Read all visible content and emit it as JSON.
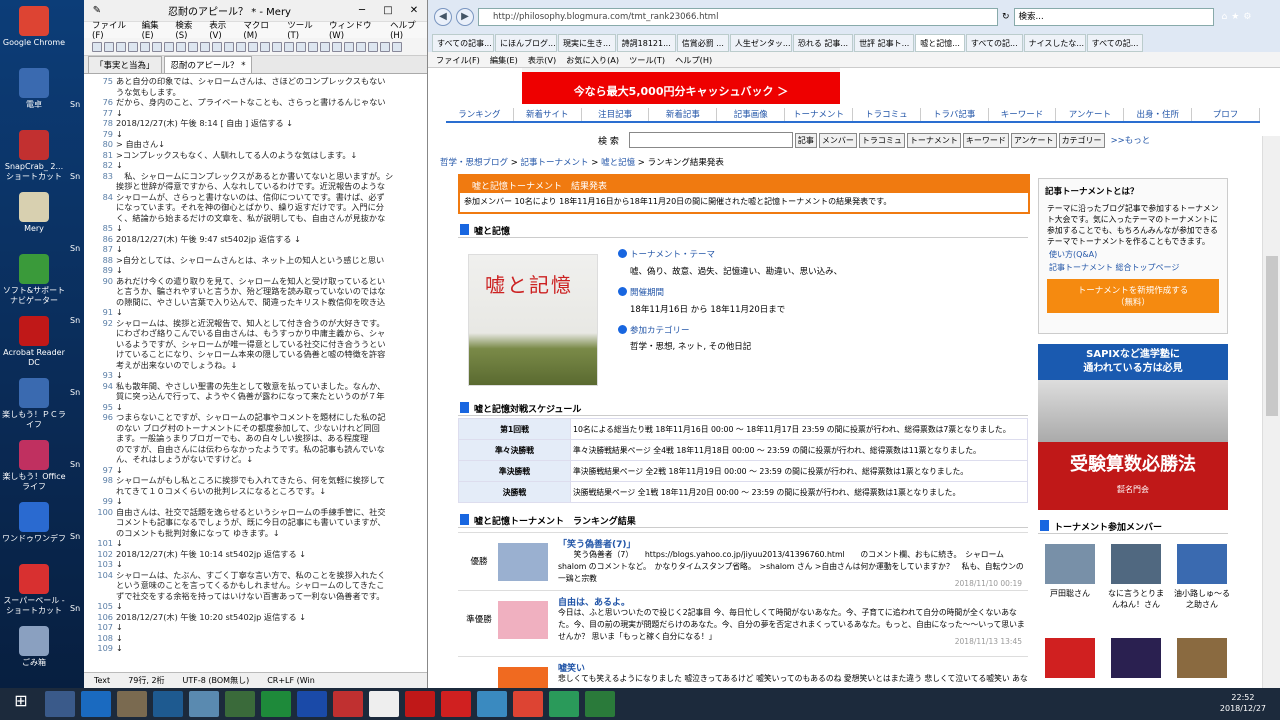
{
  "desktop": {
    "icons": [
      {
        "label": "Google Chrome",
        "color": "#dd4433"
      },
      {
        "label": "電卓",
        "color": "#3a6ab0"
      },
      {
        "label": "SnapCrab_ 2... ショートカット",
        "color": "#c23030"
      },
      {
        "label": "Mery",
        "color": "#d8d0b0"
      },
      {
        "label": "ソフト&サポートナビゲーター",
        "color": "#3a9a3a"
      },
      {
        "label": "Acrobat Reader DC",
        "color": "#c01818"
      },
      {
        "label": "楽しもう！ＰＣライフ",
        "color": "#3a6ab0"
      },
      {
        "label": "楽しもう！Office ライフ",
        "color": "#c03060"
      },
      {
        "label": "ワンドゥワンデフ",
        "color": "#2a6ad0"
      },
      {
        "label": "スーパーペール - ショートカット",
        "color": "#d83030"
      },
      {
        "label": "ごみ箱",
        "color": "#8aa0c0"
      }
    ],
    "side_labels": [
      "Sn",
      "Sn",
      "Sn",
      "Sn",
      "Sn",
      "Sn",
      "Sn",
      "Sn"
    ]
  },
  "mery": {
    "title": "忍耐のアピール？ * - Mery",
    "menu": [
      "ファイル(F)",
      "編集(E)",
      "検索(S)",
      "表示(V)",
      "マクロ(M)",
      "ツール(T)",
      "ウィンドウ(W)",
      "ヘルプ(H)"
    ],
    "tabs": [
      "「事実と当為」",
      "忍耐のアピール？ *"
    ],
    "lines": [
      {
        "n": "75",
        "t": "あと自分の印象では、シャロームさんは、さほどのコンプレックスもない"
      },
      {
        "n": "",
        "t": "うな気もします。"
      },
      {
        "n": "76",
        "t": "だから、身内のこと、プライベートなことも、さらっと書けるんじゃない"
      },
      {
        "n": "77",
        "t": "↓"
      },
      {
        "n": "78",
        "t": "2018/12/27(木) 午後 8:14 [ 自由 ] 返信する ↓"
      },
      {
        "n": "79",
        "t": "↓"
      },
      {
        "n": "80",
        "t": "> 自由さん↓"
      },
      {
        "n": "81",
        "t": ">コンプレックスもなく、人馴れしてる人のような気はします。↓"
      },
      {
        "n": "82",
        "t": "↓"
      },
      {
        "n": "83",
        "t": "　私、シャロームにコンプレックスがあるとか書いてないと思いますが。シ"
      },
      {
        "n": "",
        "t": "挨拶と世辞が得意ですから、人なれしているわけです。近況報告のような"
      },
      {
        "n": "84",
        "t": "シャロームが、さらっと書けないのは、信仰についてです。書けば、必ず"
      },
      {
        "n": "",
        "t": "になっています。それを神の御心とばかり、繰り返すだけです。入門に分"
      },
      {
        "n": "",
        "t": "く、結論から始まるだけの文章を、私が説明しても、自由さんが見抜かな"
      },
      {
        "n": "85",
        "t": "↓"
      },
      {
        "n": "86",
        "t": "2018/12/27(木) 午後 9:47 st5402jp 返信する ↓"
      },
      {
        "n": "87",
        "t": "↓"
      },
      {
        "n": "88",
        "t": ">自分としては、シャロームさんとは、ネット上の知人という感じと思い"
      },
      {
        "n": "89",
        "t": "↓"
      },
      {
        "n": "90",
        "t": "あれだけ今くの遣り取りを見て、シャロームを知人と受け取っているとい"
      },
      {
        "n": "",
        "t": "と言うか、騙されやすいと言うか、殆ど理路を読み取っていないのではな"
      },
      {
        "n": "",
        "t": "の隙間に、やさしい言葉で入り込んで、間違ったキリスト教信仰を吹き込"
      },
      {
        "n": "91",
        "t": "↓"
      },
      {
        "n": "92",
        "t": "シャロームは、挨拶と近況報告で、知人として付き合うのが大好きです。"
      },
      {
        "n": "",
        "t": "にわざわざ絡りこんでいる自由さんは、もうすっかり中庸主義から、シャ"
      },
      {
        "n": "",
        "t": "いるようですが、シャロームが唯一得意としている社交に付き合ううとい"
      },
      {
        "n": "",
        "t": "けていることになり、シャローム本来の隠している偽善と嘘の特徴を許容"
      },
      {
        "n": "",
        "t": "考えが出来ないのでしょうね。↓"
      },
      {
        "n": "93",
        "t": "↓"
      },
      {
        "n": "94",
        "t": "私も散年間、やさしい聖書の先生として敬意を払っていました。なんか、"
      },
      {
        "n": "",
        "t": "質に突っ込んで行って、ようやく偽善が露わになって来たというのが７年"
      },
      {
        "n": "95",
        "t": "↓"
      },
      {
        "n": "96",
        "t": "つまらないことですが、シャロームの記事やコメントを題材にした私の記"
      },
      {
        "n": "",
        "t": "のない ブログ村のトーナメントにその都度参加して、少ないけれど同回"
      },
      {
        "n": "",
        "t": "ます。一般論ぅまりブロガーでも、あの白々しい挨拶は、ある程度理"
      },
      {
        "n": "",
        "t": "のですが、自由さんには伝わらなかったようです。私の記事も読んでいな"
      },
      {
        "n": "",
        "t": "ん、それはしょうがないですけど。↓"
      },
      {
        "n": "97",
        "t": "↓"
      },
      {
        "n": "98",
        "t": "シャロームがもし私ところに挨拶でも入れてきたら、何を気軽に挨拶して"
      },
      {
        "n": "",
        "t": "れてきて１０コメくらいの批判レスになるところです。↓"
      },
      {
        "n": "99",
        "t": "↓"
      },
      {
        "n": "100",
        "t": "自由さんは、社交で話題を逸らせるというシャロームの手練手管に、社交"
      },
      {
        "n": "",
        "t": "コメントも記事になるでしょうが、既に今日の記事にも書いていますが、"
      },
      {
        "n": "",
        "t": "のコメントも批判対象になって ゆきます。↓"
      },
      {
        "n": "101",
        "t": "↓"
      },
      {
        "n": "102",
        "t": "2018/12/27(木) 午後 10:14 st5402jp 返信する ↓"
      },
      {
        "n": "103",
        "t": "↓"
      },
      {
        "n": "104",
        "t": "シャロームは、たぶん、すごく丁寧な言い方で、私のことを挨拶入れたく"
      },
      {
        "n": "",
        "t": "という意味のことを言ってくるかもしれません。シャロームのしてきたこ"
      },
      {
        "n": "",
        "t": "ずで社交をする余裕を持ってはいけない百害あって一利ない偽善者です。"
      },
      {
        "n": "105",
        "t": "↓"
      },
      {
        "n": "106",
        "t": "2018/12/27(木) 午後 10:20 st5402jp 返信する ↓"
      },
      {
        "n": "107",
        "t": "↓"
      },
      {
        "n": "108",
        "t": "↓"
      },
      {
        "n": "109",
        "t": "↓"
      }
    ],
    "status": [
      "Text",
      "79行, 2桁",
      "UTF-8 (BOM無し)",
      "CR+LF (Win"
    ]
  },
  "ie": {
    "url": "http://philosophy.blogmura.com/tmt_rank23066.html",
    "search_ph": "検索...",
    "tabs": [
      "すべての記事...",
      "にほんブログ...",
      "現実に生き...",
      "詩詞18121...",
      "信賞必罰 ...",
      "人生ゼンタッ...",
      "恐れる 記事...",
      "世評 記事ト...",
      "嘘と記憶...",
      "すべての記...",
      "ナイスしたな...",
      "すべての記..."
    ],
    "menu": [
      "ファイル(F)",
      "編集(E)",
      "表示(V)",
      "お気に入り(A)",
      "ツール(T)",
      "ヘルプ(H)"
    ]
  },
  "page": {
    "banner": "今なら最大5,000円分キャッシュバック ＞",
    "nav": [
      "ランキング",
      "新着サイト",
      "注目記事",
      "新着記事",
      "記事画像",
      "トーナメント",
      "トラコミュ",
      "トラバ記事",
      "キーワード",
      "アンケート",
      "出身・住所",
      "プロフ"
    ],
    "search_label": "検 索",
    "search_btns": [
      "記事",
      "メンバー",
      "トラコミュ",
      "トーナメント",
      "キーワード",
      "アンケート",
      "カテゴリー"
    ],
    "more": ">>もっと",
    "crumb": [
      "哲学・思想ブログ",
      "記事トーナメント",
      "嘘と記憶",
      "ランキング結果発表"
    ],
    "result_head": "嘘と記憶トーナメント　結果発表",
    "result_body": "参加メンバー 10名により 18年11月16日から18年11月20日の間に開催された嘘と記憶トーナメントの結果発表です。",
    "sec_title": "嘘と記憶",
    "photo_title": "嘘と記憶",
    "theme_h": "トーナメント・テーマ",
    "theme": "嘘、偽り、故意、過失、記憶違い、勘違い、思い込み、",
    "period_h": "開催期間",
    "period": "18年11月16日 から 18年11月20日まで",
    "cat_h": "参加カテゴリー",
    "cat": "哲学・思想, ネット, その他日記",
    "sched_title": "嘘と記憶対戦スケジュール",
    "sched": [
      {
        "k": "第1回戦",
        "v": "10名による総当たり戦 18年11月16日 00:00 ～ 18年11月17日 23:59 の間に投票が行われ、総得票数は7票となりました。"
      },
      {
        "k": "準々決勝戦",
        "v": "準々決勝戦結果ページ 全4戦 18年11月18日 00:00 ～ 23:59 の間に投票が行われ、総得票数は11票となりました。"
      },
      {
        "k": "準決勝戦",
        "v": "準決勝戦結果ページ 全2戦 18年11月19日 00:00 ～ 23:59 の間に投票が行われ、総得票数は1票となりました。"
      },
      {
        "k": "決勝戦",
        "v": "決勝戦結果ページ 全1戦 18年11月20日 00:00 ～ 23:59 の間に投票が行われ、総得票数は1票となりました。"
      }
    ],
    "rank_title": "嘘と記憶トーナメント　ランキング結果",
    "ranks": [
      {
        "place": "優勝",
        "title": "「笑う偽善者(7)」",
        "text": "　　笑う偽善者（7）　　https://blogs.yahoo.co.jp/jiyuu2013/41396760.html　　のコメント欄、おもに続き。　シャローム shalom のコメントなど。　かなりタイムスタンプ省略。　>shalom さん >自由さんは何か運動をしていますか？　私も、自転ウンの一鶏と宗教",
        "date": "2018/11/10 00:19"
      },
      {
        "place": "準優勝",
        "title": "自由は、あるよ。",
        "text": "今日は、ふと思いついたので投じく2記事目 今、毎日忙しくて時間がないあなた。今、子育てに追われて自分の時間が全くないあなた。今、目の前の現実が問題だらけのあなた。今、自分の夢を否定されまくっているあなた。もっと、自由になった〜〜いって思いませんか？ 思いま「もっと稼く自分になる！」",
        "date": "2018/11/13 13:45"
      },
      {
        "place": "",
        "title": "嘘笑い",
        "text": "悲しくても笑えるようになりました 嘘泣きってあるけど 嘘笑いってのもあるのね 愛想笑いとはまた違う 悲しくて泣いてる嘘笑い あな",
        "date": ""
      }
    ],
    "side_title": "記事トーナメントとは？",
    "side_text": "テーマに沿ったブログ記事で参加するトーナメント大会です。気に入ったテーマのトーナメントに参加することでも、もちろんみんなが参加できるテーマでトーナメントを作ることもできます。",
    "side_links": [
      "使い方(Q&A)",
      "記事トーナメント 総合トップページ"
    ],
    "create_btn": "トーナメントを新規作成する\n（無料）",
    "ad_top": "SAPIXなど進学塾に\n通われている方は必見",
    "ad_big": "受験算数必勝法",
    "ad_foot": "㍿名門会",
    "members_title": "トーナメント参加メンバー",
    "members": [
      "戸田聡さん",
      "なに言うとりまんねん！さん",
      "油小路しゅ〜る之助さん"
    ]
  },
  "taskbar": {
    "time": "22:52",
    "date": "2018/12/27"
  }
}
